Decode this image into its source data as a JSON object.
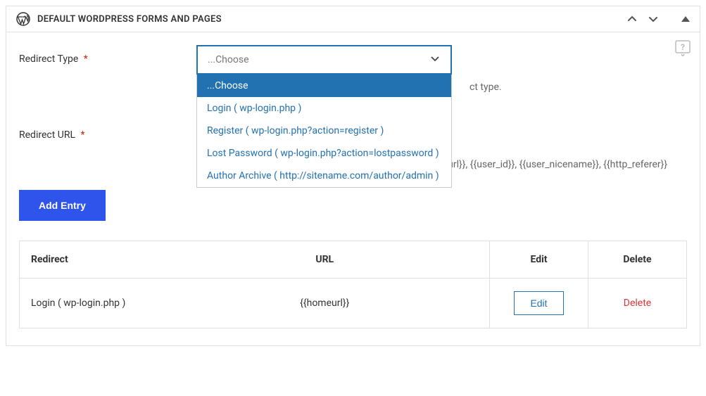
{
  "panel": {
    "title": "DEFAULT WORDPRESS FORMS AND PAGES"
  },
  "form": {
    "redirect_type_label": "Redirect Type",
    "redirect_url_label": "Redirect URL",
    "required_marker": "*",
    "select_placeholder": "...Choose",
    "dropdown_options": [
      "...Choose",
      "Login ( wp-login.php )",
      "Register ( wp-login.php?action=register )",
      "Lost Password ( wp-login.php?action=lostpassword )",
      "Author Archive ( http://sitename.com/author/admin )"
    ],
    "type_help_suffix": "ct type.",
    "url_hint": "Can contain the following dynamic tags:{{homeurl}}, {{siteurl}}, {{user_id}}, {{user_nicename}}, {{http_referer}}",
    "add_entry_label": "Add Entry"
  },
  "table": {
    "headers": {
      "redirect": "Redirect",
      "url": "URL",
      "edit": "Edit",
      "delete": "Delete"
    },
    "rows": [
      {
        "redirect": "Login ( wp-login.php )",
        "url": "{{homeurl}}",
        "edit_label": "Edit",
        "delete_label": "Delete"
      }
    ]
  }
}
